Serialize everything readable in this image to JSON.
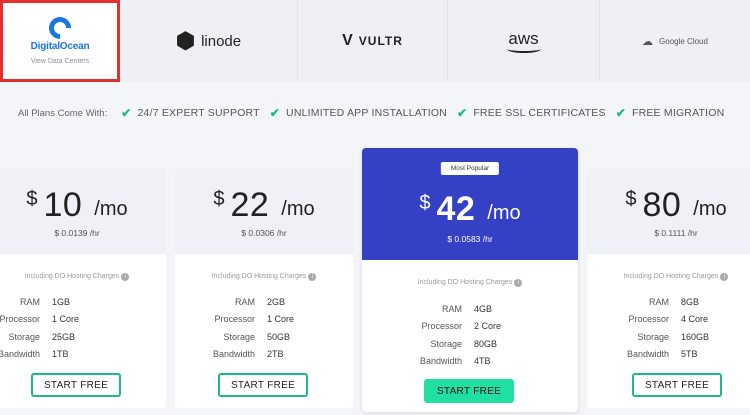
{
  "providers": {
    "digitalocean": {
      "name": "DigitalOcean",
      "sub": "View Data Centers",
      "active": true
    },
    "linode": {
      "name": "linode"
    },
    "vultr": {
      "name": "VULTR"
    },
    "aws": {
      "name": "aws"
    },
    "google": {
      "name": "Google Cloud"
    }
  },
  "features": {
    "intro": "All Plans Come With:",
    "items": [
      "24/7 EXPERT SUPPORT",
      "UNLIMITED APP INSTALLATION",
      "FREE SSL CERTIFICATES",
      "FREE MIGRATION"
    ]
  },
  "plans": [
    {
      "currency": "$",
      "amount": "10",
      "period": "/mo",
      "hourly": "$ 0.0139 /hr",
      "including": "Including DO Hosting Charges",
      "specs": [
        {
          "key": "RAM",
          "value": "1GB"
        },
        {
          "key": "Processor",
          "value": "1 Core"
        },
        {
          "key": "Storage",
          "value": "25GB"
        },
        {
          "key": "Bandwidth",
          "value": "1TB"
        }
      ],
      "cta": "START FREE"
    },
    {
      "currency": "$",
      "amount": "22",
      "period": "/mo",
      "hourly": "$ 0.0306 /hr",
      "including": "Including DO Hosting Charges",
      "specs": [
        {
          "key": "RAM",
          "value": "2GB"
        },
        {
          "key": "Processor",
          "value": "1 Core"
        },
        {
          "key": "Storage",
          "value": "50GB"
        },
        {
          "key": "Bandwidth",
          "value": "2TB"
        }
      ],
      "cta": "START FREE"
    },
    {
      "badge": "Most Popular",
      "currency": "$",
      "amount": "42",
      "period": "/mo",
      "hourly": "$ 0.0583 /hr",
      "including": "Including DO Hosting Charges",
      "specs": [
        {
          "key": "RAM",
          "value": "4GB"
        },
        {
          "key": "Processor",
          "value": "2 Core"
        },
        {
          "key": "Storage",
          "value": "80GB"
        },
        {
          "key": "Bandwidth",
          "value": "4TB"
        }
      ],
      "cta": "START FREE"
    },
    {
      "currency": "$",
      "amount": "80",
      "period": "/mo",
      "hourly": "$ 0.1111 /hr",
      "including": "Including DO Hosting Charges",
      "specs": [
        {
          "key": "RAM",
          "value": "8GB"
        },
        {
          "key": "Processor",
          "value": "4 Core"
        },
        {
          "key": "Storage",
          "value": "160GB"
        },
        {
          "key": "Bandwidth",
          "value": "5TB"
        }
      ],
      "cta": "START FREE"
    }
  ],
  "colors": {
    "accent": "#3441c4",
    "cta": "#1db98a",
    "highlight_border": "#e53030",
    "do_blue": "#1b74e4"
  }
}
